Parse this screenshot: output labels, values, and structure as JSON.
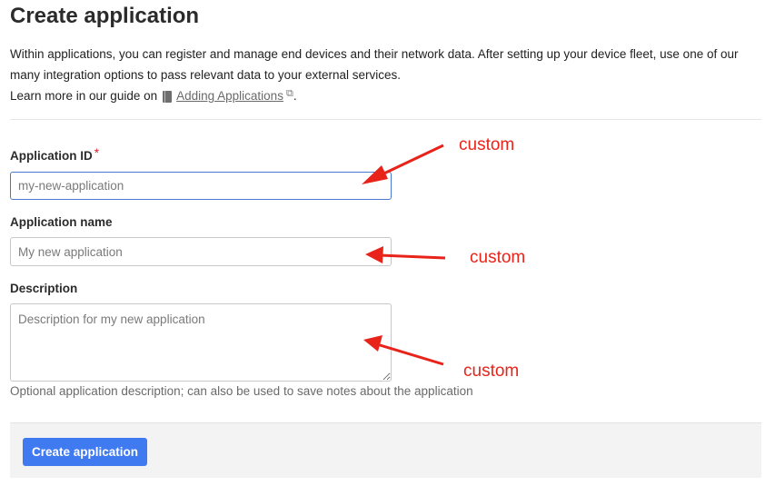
{
  "page": {
    "title": "Create application",
    "intro_line1": "Within applications, you can register and manage end devices and their network data. After setting up your device fleet, use one of our many integration options to pass relevant data to your external services.",
    "intro_learn_prefix": "Learn more in our guide on",
    "guide_link": "Adding Applications",
    "intro_suffix": "."
  },
  "form": {
    "application_id": {
      "label": "Application ID",
      "required_mark": "*",
      "placeholder": "my-new-application",
      "value": ""
    },
    "application_name": {
      "label": "Application name",
      "placeholder": "My new application",
      "value": ""
    },
    "description": {
      "label": "Description",
      "placeholder": "Description for my new application",
      "value": "",
      "hint": "Optional application description; can also be used to save notes about the application"
    }
  },
  "footer": {
    "submit_label": "Create application"
  },
  "annotations": [
    {
      "text": "custom",
      "color": "#e8231a"
    },
    {
      "text": "custom",
      "color": "#e8231a"
    },
    {
      "text": "custom",
      "color": "#e8231a"
    }
  ],
  "colors": {
    "primary": "#3f7af0",
    "required": "#e0202d",
    "focus_border": "#4a78d0",
    "annotation": "#e8231a"
  },
  "icons": {
    "guide": "book-icon",
    "external": "external-link-icon"
  }
}
